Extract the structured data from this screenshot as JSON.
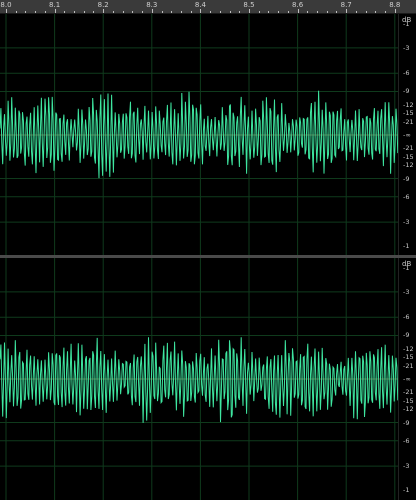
{
  "ruler": {
    "ticks": [
      "8.0",
      "8.1",
      "8.2",
      "8.3",
      "8.4",
      "8.5",
      "8.6",
      "8.7",
      "8.8"
    ]
  },
  "channels": [
    {
      "unit": "dB",
      "scale_labels": [
        "-1",
        "-3",
        "-6",
        "-9",
        "-12",
        "-15",
        "-21",
        "-∞",
        "-21",
        "-15",
        "-12",
        "-9",
        "-6",
        "-3",
        "-1"
      ]
    },
    {
      "unit": "dB",
      "scale_labels": [
        "-1",
        "-3",
        "-6",
        "-9",
        "-12",
        "-15",
        "-21",
        "-∞",
        "-21",
        "-15",
        "-12",
        "-9",
        "-6",
        "-3",
        "-1"
      ]
    }
  ],
  "colors": {
    "waveform": "#3ee6a0",
    "grid": "#0f3a1c",
    "center_line": "#6b4a2a",
    "ruler_bg": "#3a3a3a"
  },
  "icons": {
    "corner": "zoom-toggle-icon"
  }
}
